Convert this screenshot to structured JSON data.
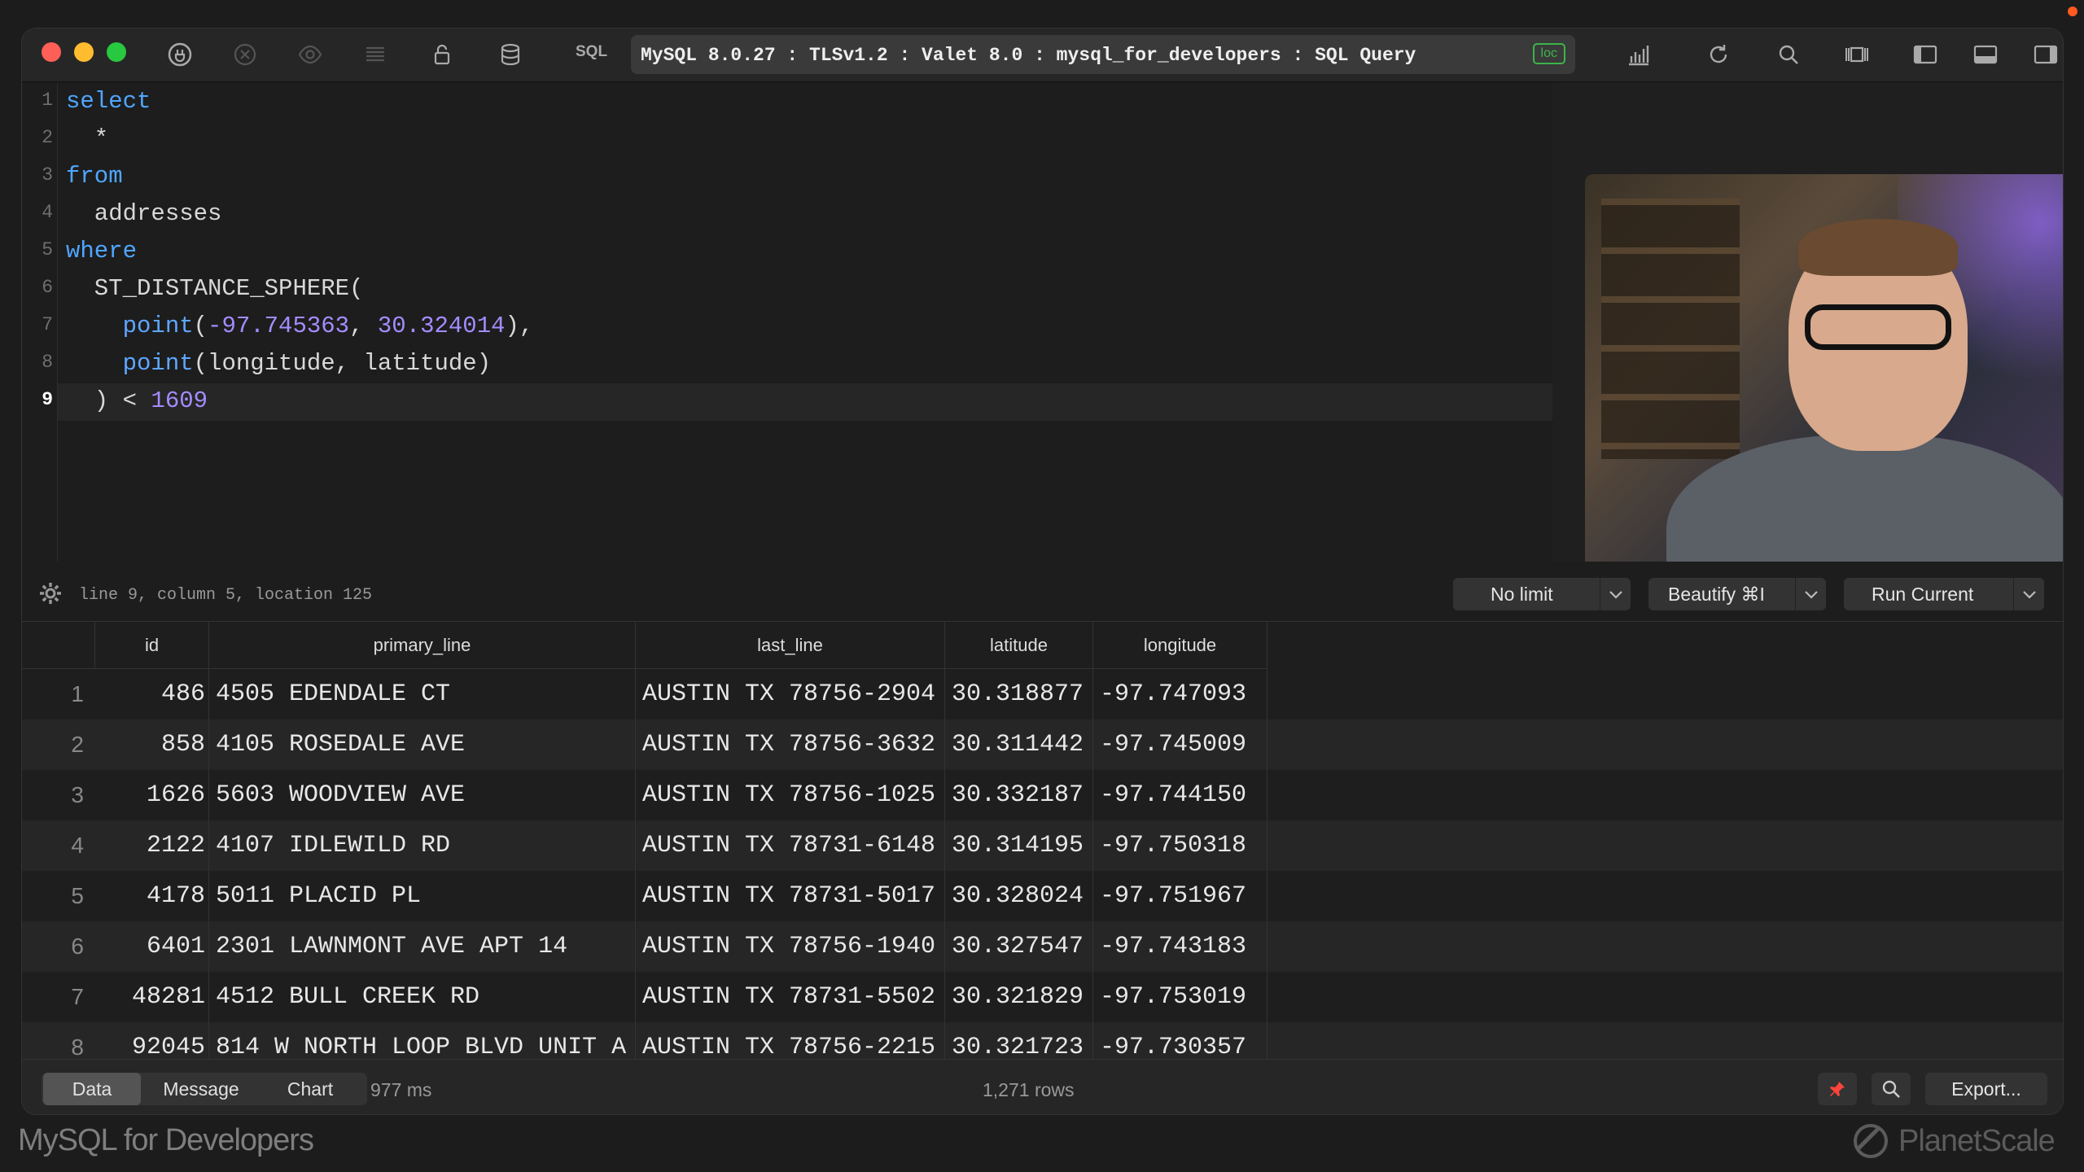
{
  "toolbar": {
    "sql_label": "SQL",
    "connection": "MySQL 8.0.27 : TLSv1.2 : Valet 8.0 : mysql_for_developers : SQL Query",
    "loc_badge": "loc"
  },
  "editor": {
    "line_numbers": [
      "1",
      "2",
      "3",
      "4",
      "5",
      "6",
      "7",
      "8",
      "9"
    ],
    "lines": {
      "l1": "select",
      "l2": "  *",
      "l3": "from",
      "l4": "  addresses",
      "l5": "where",
      "l6": "  ST_DISTANCE_SPHERE(",
      "l7_fn": "point",
      "l7_a": "-97.745363",
      "l7_b": "30.324014",
      "l8_fn": "point",
      "l8_args": "(longitude, latitude)",
      "l9_op": "  ) < ",
      "l9_num": "1609"
    },
    "cursor_position": "line 9, column 5, location 125"
  },
  "controls": {
    "limit_label": "No limit",
    "beautify_label": "Beautify ⌘I",
    "run_label": "Run Current"
  },
  "results": {
    "columns": [
      "id",
      "primary_line",
      "last_line",
      "latitude",
      "longitude"
    ],
    "rows": [
      {
        "n": "1",
        "id": "486",
        "primary_line": "4505 EDENDALE CT",
        "last_line": "AUSTIN TX 78756-2904",
        "latitude": "30.318877",
        "longitude": "-97.747093"
      },
      {
        "n": "2",
        "id": "858",
        "primary_line": "4105 ROSEDALE AVE",
        "last_line": "AUSTIN TX 78756-3632",
        "latitude": "30.311442",
        "longitude": "-97.745009"
      },
      {
        "n": "3",
        "id": "1626",
        "primary_line": "5603 WOODVIEW AVE",
        "last_line": "AUSTIN TX 78756-1025",
        "latitude": "30.332187",
        "longitude": "-97.744150"
      },
      {
        "n": "4",
        "id": "2122",
        "primary_line": "4107 IDLEWILD RD",
        "last_line": "AUSTIN TX 78731-6148",
        "latitude": "30.314195",
        "longitude": "-97.750318"
      },
      {
        "n": "5",
        "id": "4178",
        "primary_line": "5011 PLACID PL",
        "last_line": "AUSTIN TX 78731-5017",
        "latitude": "30.328024",
        "longitude": "-97.751967"
      },
      {
        "n": "6",
        "id": "6401",
        "primary_line": "2301 LAWNMONT AVE APT 14",
        "last_line": "AUSTIN TX 78756-1940",
        "latitude": "30.327547",
        "longitude": "-97.743183"
      },
      {
        "n": "7",
        "id": "48281",
        "primary_line": "4512 BULL CREEK RD",
        "last_line": "AUSTIN TX 78731-5502",
        "latitude": "30.321829",
        "longitude": "-97.753019"
      },
      {
        "n": "8",
        "id": "92045",
        "primary_line": "814 W NORTH LOOP BLVD UNIT A",
        "last_line": "AUSTIN TX 78756-2215",
        "latitude": "30.321723",
        "longitude": "-97.730357"
      }
    ]
  },
  "bottom": {
    "tabs": [
      "Data",
      "Message",
      "Chart"
    ],
    "timing": "977 ms",
    "row_count": "1,271 rows",
    "export_label": "Export..."
  },
  "branding": {
    "left": "MySQL for Developers",
    "right": "PlanetScale"
  },
  "colors": {
    "keyword": "#4fa6ff",
    "number": "#a48cff",
    "accent_red": "#ff453a",
    "loc_green": "#3bb54a"
  }
}
